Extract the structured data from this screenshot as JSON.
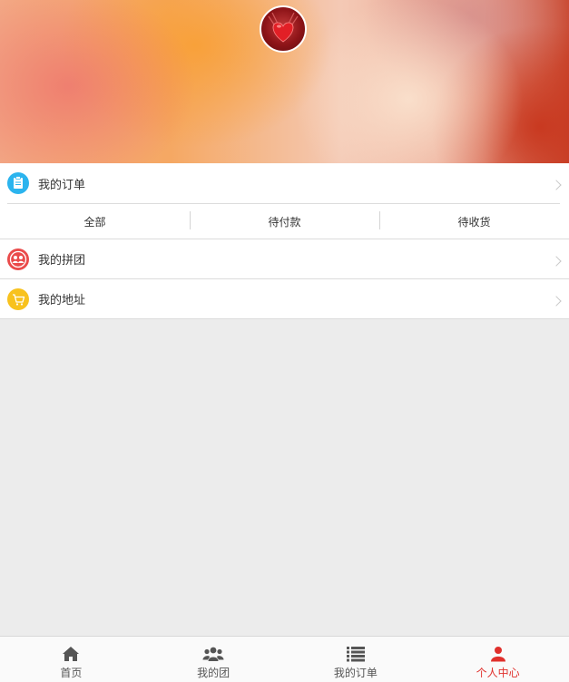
{
  "profile": {
    "avatar_icon": "heart-avatar"
  },
  "menu": {
    "orders_label": "我的订单",
    "orders_icon": "clipboard-icon",
    "order_tabs": [
      "全部",
      "待付款",
      "待收货"
    ],
    "group_label": "我的拼团",
    "group_icon": "group-icon",
    "address_label": "我的地址",
    "address_icon": "cart-icon"
  },
  "nav": {
    "items": [
      {
        "label": "首页",
        "icon": "home-icon",
        "active": false
      },
      {
        "label": "我的团",
        "icon": "users-icon",
        "active": false
      },
      {
        "label": "我的订单",
        "icon": "list-icon",
        "active": false
      },
      {
        "label": "个人中心",
        "icon": "user-icon",
        "active": true
      }
    ]
  },
  "colors": {
    "accent": "#e0302c",
    "orders_icon_bg": "#2bb4ee",
    "group_icon_bg": "#ea4b4b",
    "address_icon_bg": "#f8c21e"
  }
}
